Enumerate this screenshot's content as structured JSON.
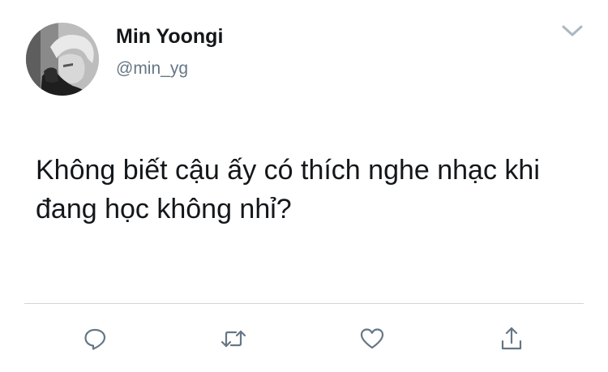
{
  "tweet": {
    "display_name": "Min Yoongi",
    "handle": "@min_yg",
    "text": "Không biết cậu ấy có thích nghe nhạc khi đang học không nhỉ?"
  },
  "icons": {
    "caret": "chevron-down-icon",
    "reply": "reply-icon",
    "retweet": "retweet-icon",
    "like": "heart-icon",
    "share": "share-icon"
  },
  "colors": {
    "text": "#14171a",
    "secondary": "#657786",
    "icon": "#657786",
    "divider": "#d4d4d4"
  }
}
